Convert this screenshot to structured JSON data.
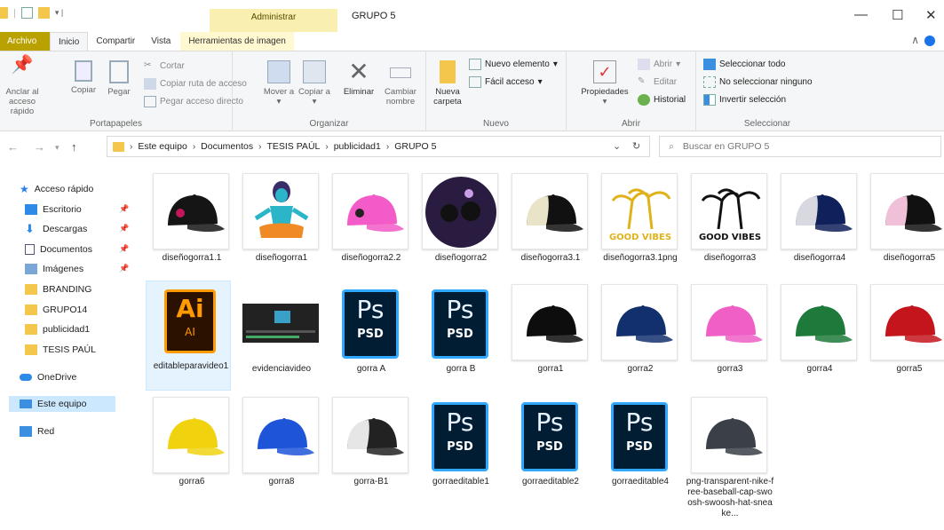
{
  "window": {
    "title": "GRUPO 5",
    "context_tab": "Administrar",
    "controls": {
      "minimize": "—",
      "maximize": "☐",
      "close": "✕"
    }
  },
  "ribbon_tabs": [
    "Archivo",
    "Inicio",
    "Compartir",
    "Vista",
    "Herramientas de imagen"
  ],
  "ribbon": {
    "clipboard": {
      "label": "Portapapeles",
      "pin": "Anclar al acceso rápido",
      "copy": "Copiar",
      "paste": "Pegar",
      "cut": "Cortar",
      "copy_path": "Copiar ruta de acceso",
      "paste_shortcut": "Pegar acceso directo"
    },
    "organize": {
      "label": "Organizar",
      "move": "Mover a",
      "copy_to": "Copiar a",
      "delete": "Eliminar",
      "rename": "Cambiar nombre"
    },
    "new": {
      "label": "Nuevo",
      "new_folder": "Nueva carpeta",
      "new_item": "Nuevo elemento",
      "easy_access": "Fácil acceso"
    },
    "open": {
      "label": "Abrir",
      "properties": "Propiedades",
      "open": "Abrir",
      "edit": "Editar",
      "history": "Historial"
    },
    "select": {
      "label": "Seleccionar",
      "select_all": "Seleccionar todo",
      "select_none": "No seleccionar ninguno",
      "invert": "Invertir selección"
    }
  },
  "address": {
    "crumbs": [
      "Este equipo",
      "Documentos",
      "TESIS PAÚL",
      "publicidad1",
      "GRUPO 5"
    ],
    "search_placeholder": "Buscar en GRUPO 5"
  },
  "sidebar": {
    "quick_access": "Acceso rápido",
    "items": [
      {
        "label": "Escritorio",
        "pinned": true
      },
      {
        "label": "Descargas",
        "pinned": true
      },
      {
        "label": "Documentos",
        "pinned": true
      },
      {
        "label": "Imágenes",
        "pinned": true
      },
      {
        "label": "BRANDING"
      },
      {
        "label": "GRUPO14"
      },
      {
        "label": "publicidad1"
      },
      {
        "label": "TESIS PAÚL"
      }
    ],
    "onedrive": "OneDrive",
    "this_pc": "Este equipo",
    "network": "Red"
  },
  "files": [
    {
      "name": "diseñogorra1.1",
      "kind": "cap",
      "color": "#151515",
      "accent": "#c2185b"
    },
    {
      "name": "diseñogorra1",
      "kind": "figure",
      "color": "#2bb5c8"
    },
    {
      "name": "diseñogorra2.2",
      "kind": "cap",
      "color": "#f25bc8",
      "accent": "#222"
    },
    {
      "name": "diseñogorra2",
      "kind": "circle",
      "color": "#2a1c40"
    },
    {
      "name": "diseñogorra3.1",
      "kind": "trucker",
      "color": "#111",
      "accent": "#e9e3c8"
    },
    {
      "name": "diseñogorra3.1png",
      "kind": "palms",
      "color": "#e0b21a"
    },
    {
      "name": "diseñogorra3",
      "kind": "palms",
      "color": "#111"
    },
    {
      "name": "diseñogorra4",
      "kind": "trucker",
      "color": "#10205a",
      "accent": "#d8d8e0"
    },
    {
      "name": "diseñogorra5",
      "kind": "trucker",
      "color": "#111",
      "accent": "#f0c0d8"
    },
    {
      "name": "editableparavideo1",
      "kind": "ai",
      "selected": true
    },
    {
      "name": "evidenciavideo",
      "kind": "video"
    },
    {
      "name": "gorra A",
      "kind": "psd"
    },
    {
      "name": "gorra B",
      "kind": "psd"
    },
    {
      "name": "gorra1",
      "kind": "cap",
      "color": "#0d0d0d"
    },
    {
      "name": "gorra2",
      "kind": "cap",
      "color": "#13306e"
    },
    {
      "name": "gorra3",
      "kind": "cap",
      "color": "#ef5fc5"
    },
    {
      "name": "gorra4",
      "kind": "cap",
      "color": "#1d7a3a"
    },
    {
      "name": "gorra5",
      "kind": "cap",
      "color": "#c4151c"
    },
    {
      "name": "gorra6",
      "kind": "cap",
      "color": "#f1d20f"
    },
    {
      "name": "gorra8",
      "kind": "cap",
      "color": "#1e55d8"
    },
    {
      "name": "gorra-B1",
      "kind": "trucker",
      "color": "#222",
      "accent": "#e6e6e6"
    },
    {
      "name": "gorraeditable1",
      "kind": "psd"
    },
    {
      "name": "gorraeditable2",
      "kind": "psd"
    },
    {
      "name": "gorraeditable4",
      "kind": "psd"
    },
    {
      "name": "png-transparent-nike-free-baseball-cap-swoosh-swoosh-hat-sneake...",
      "kind": "cap",
      "color": "#3a3f48"
    }
  ],
  "icon_text": {
    "ai": "Ai",
    "ai_sub": "AI",
    "ps": "Ps",
    "ps_sub": "PSD",
    "palm_text": "GOOD VIBES"
  }
}
